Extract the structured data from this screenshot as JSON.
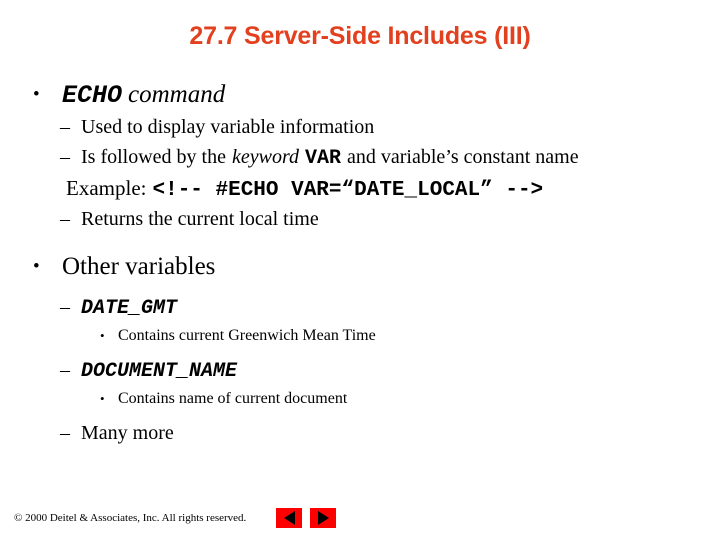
{
  "slide": {
    "title": "27.7 Server-Side Includes (III)",
    "title_color": "#E2401E",
    "background_color": "#FFFFFF"
  },
  "content": {
    "b1": {
      "marker": "•",
      "code": "ECHO",
      "text": "command"
    },
    "b1_s1": {
      "marker": "–",
      "text": "Used to display variable information"
    },
    "b1_s2": {
      "marker": "–",
      "text_before": "Is followed by the",
      "emphasis": "keyword",
      "code": "VAR",
      "text_after": "and variable’s constant name"
    },
    "b1_example": {
      "label": "Example:",
      "code": "<!-- #ECHO VAR=“DATE_LOCAL” -->"
    },
    "b1_s3": {
      "marker": "–",
      "text": "Returns the current local time"
    },
    "b2": {
      "marker": "•",
      "text": "Other variables"
    },
    "b2_s1": {
      "marker": "–",
      "code": "DATE_GMT"
    },
    "b2_s1_d1": {
      "marker": "•",
      "text": "Contains current Greenwich Mean Time"
    },
    "b2_s2": {
      "marker": "–",
      "code": "DOCUMENT_NAME"
    },
    "b2_s2_d1": {
      "marker": "•",
      "text": "Contains name of current document"
    },
    "b2_s3": {
      "marker": "–",
      "text": "Many more"
    }
  },
  "footer": {
    "copyright": "© 2000 Deitel & Associates, Inc.  All rights reserved.",
    "prev_icon": "triangle-left-icon",
    "next_icon": "triangle-right-icon",
    "button_color": "#FF0000"
  }
}
